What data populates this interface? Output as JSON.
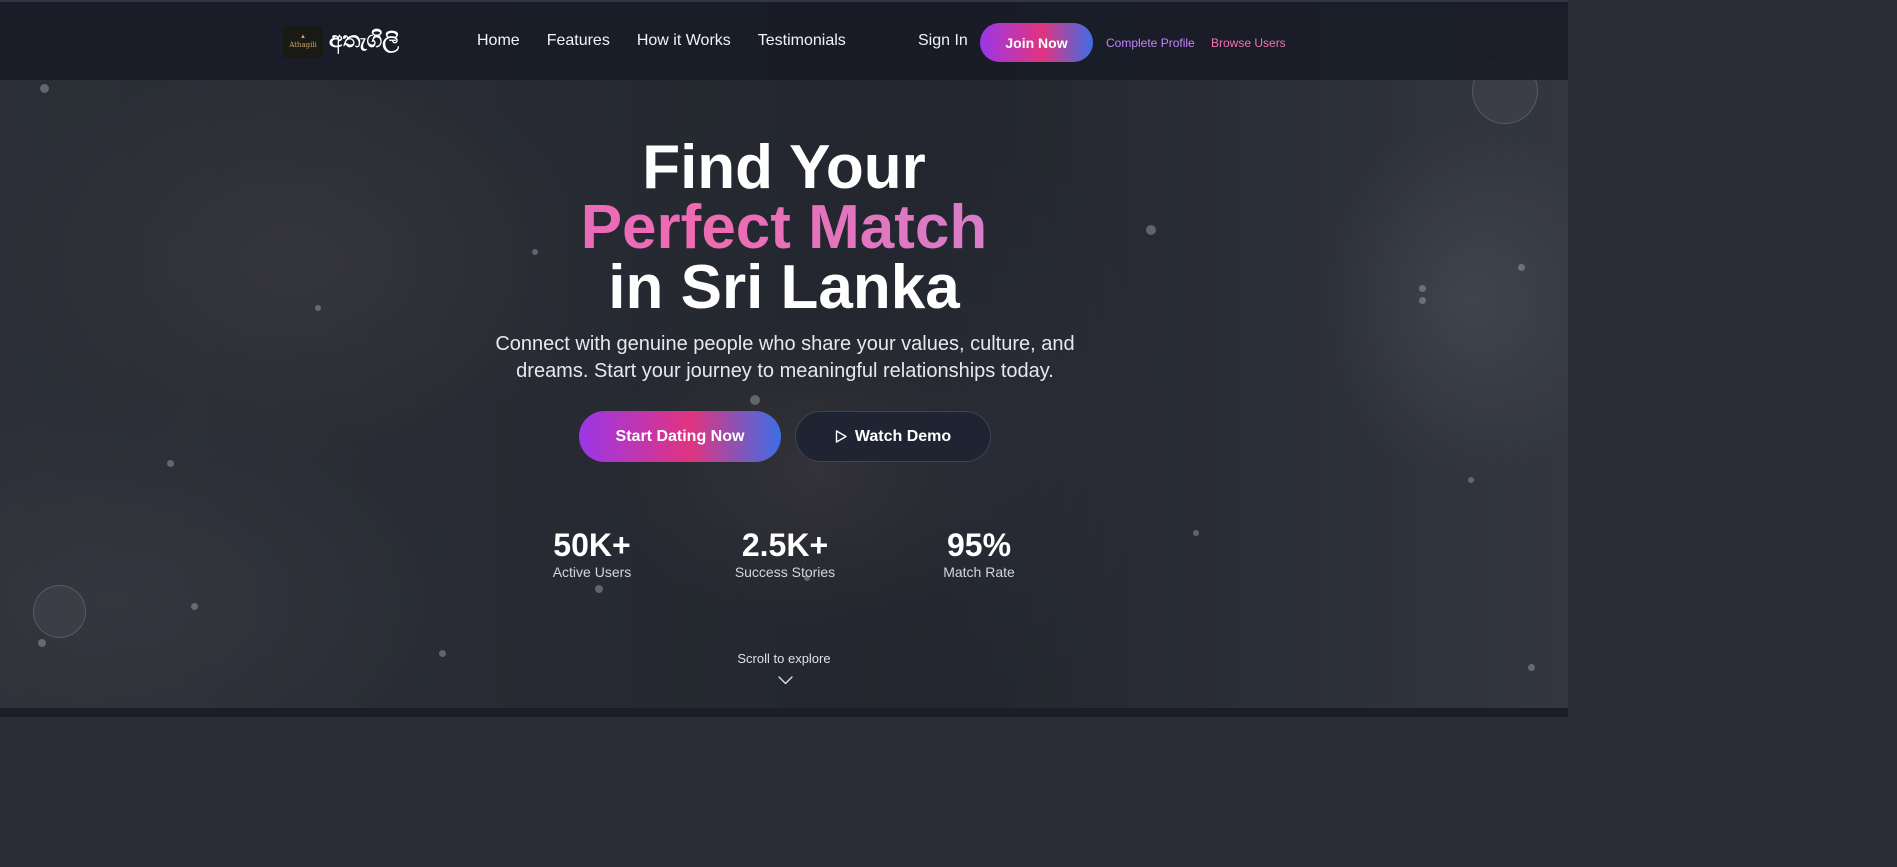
{
  "nav": {
    "logo_text": "Athagili",
    "brand_name": "අතැගිලි",
    "links": [
      "Home",
      "Features",
      "How it Works",
      "Testimonials"
    ],
    "sign_in": "Sign In",
    "join_now": "Join Now",
    "complete_profile": "Complete Profile",
    "browse_users": "Browse Users"
  },
  "hero": {
    "title_line1": "Find Your",
    "title_line2": "Perfect Match",
    "title_line3": "in Sri Lanka",
    "subtitle": "Connect with genuine people who share your values, culture, and dreams. Start your journey to meaningful relationships today.",
    "cta_primary": "Start Dating Now",
    "cta_secondary": "Watch Demo",
    "cta_secondary_icon": "play-icon"
  },
  "stats": [
    {
      "value": "50K+",
      "label": "Active Users"
    },
    {
      "value": "2.5K+",
      "label": "Success Stories"
    },
    {
      "value": "95%",
      "label": "Match Rate"
    }
  ],
  "scroll_hint": "Scroll to explore",
  "colors": {
    "accent_purple": "#9b37e8",
    "accent_pink": "#e0347f",
    "accent_blue": "#3d6ee6",
    "complete_profile": "#c084fc",
    "browse_users": "#f472b6"
  }
}
